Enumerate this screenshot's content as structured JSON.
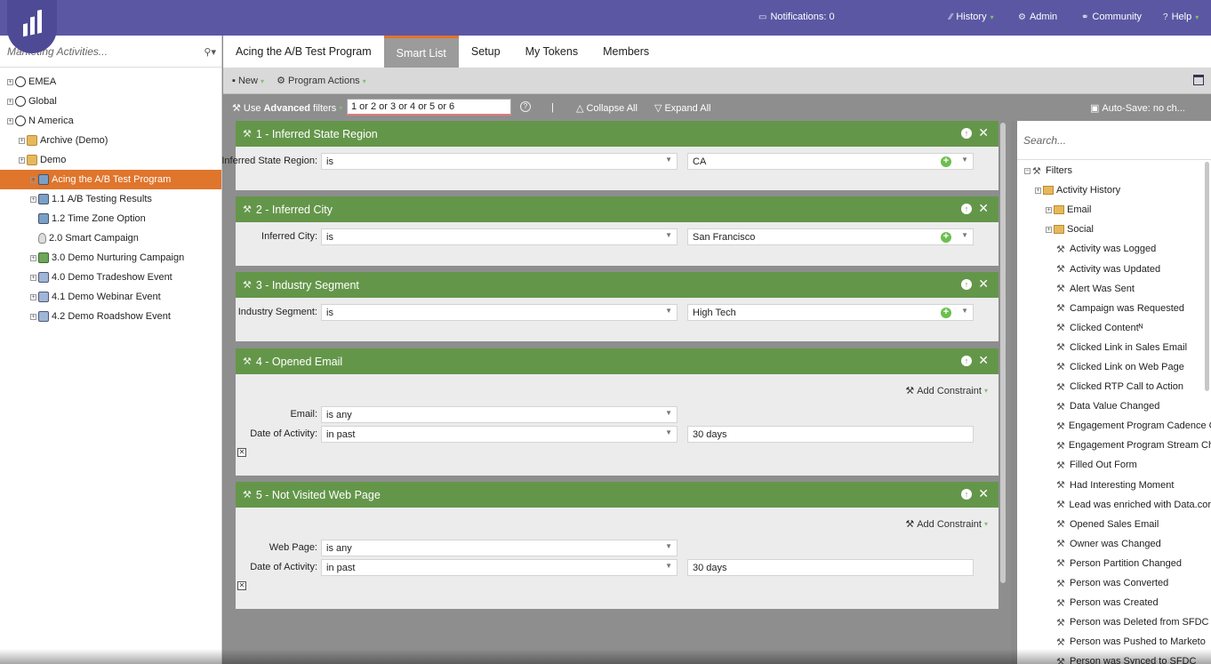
{
  "topbar": {
    "notifications": "Notifications: 0",
    "history": "History",
    "admin": "Admin",
    "community": "Community",
    "help": "Help"
  },
  "left": {
    "search_placeholder": "Marketing Activities...",
    "tree": [
      {
        "label": "EMEA",
        "icon": "globe-icon",
        "indent": 0
      },
      {
        "label": "Global",
        "icon": "globe-icon",
        "indent": 0
      },
      {
        "label": "N America",
        "icon": "globe-icon",
        "indent": 0
      },
      {
        "label": "Archive (Demo)",
        "icon": "folder-icon",
        "indent": 1
      },
      {
        "label": "Demo",
        "icon": "folder-icon",
        "indent": 1
      },
      {
        "label": "Acing the A/B Test Program",
        "icon": "program-icon",
        "indent": 2,
        "selected": true
      },
      {
        "label": "1.1 A/B Testing Results",
        "icon": "program-icon",
        "indent": 2
      },
      {
        "label": "1.2 Time Zone Option",
        "icon": "program-icon",
        "indent": 2
      },
      {
        "label": "2.0 Smart Campaign",
        "icon": "bulb-icon",
        "indent": 2
      },
      {
        "label": "3.0 Demo Nurturing Campaign",
        "icon": "nurture-icon",
        "indent": 2
      },
      {
        "label": "4.0 Demo Tradeshow Event",
        "icon": "event-icon",
        "indent": 2
      },
      {
        "label": "4.1 Demo Webinar Event",
        "icon": "event-icon",
        "indent": 2
      },
      {
        "label": "4.2 Demo Roadshow Event",
        "icon": "event-icon",
        "indent": 2
      }
    ]
  },
  "tabs": [
    "Acing the A/B Test Program",
    "Smart List",
    "Setup",
    "My Tokens",
    "Members"
  ],
  "active_tab": "Smart List",
  "toolbar": {
    "new_label": "New",
    "program_actions": "Program Actions",
    "use_advanced_prefix": "Use ",
    "use_advanced_bold": "Advanced",
    "use_advanced_suffix": " filters",
    "rule_logic": "1 or 2 or 3 or 4 or 5 or 6",
    "separator": "|",
    "collapse_all": "Collapse All",
    "expand_all": "Expand All",
    "autosave": "Auto-Save: no ch..."
  },
  "filters": [
    {
      "title": "1 - Inferred State Region",
      "rows": [
        {
          "label": "Inferred State Region:",
          "op": "is",
          "value": "CA"
        }
      ]
    },
    {
      "title": "2 - Inferred City",
      "rows": [
        {
          "label": "Inferred City:",
          "op": "is",
          "value": "San Francisco"
        }
      ]
    },
    {
      "title": "3 - Industry Segment",
      "rows": [
        {
          "label": "Industry Segment:",
          "op": "is",
          "value": "High Tech"
        }
      ]
    },
    {
      "title": "4 - Opened Email",
      "add_constraint": "Add Constraint",
      "rows": [
        {
          "label": "Email:",
          "op": "is any"
        },
        {
          "label": "Date of Activity:",
          "op": "in past",
          "value": "30 days"
        }
      ]
    },
    {
      "title": "5 - Not Visited Web Page",
      "add_constraint": "Add Constraint",
      "rows": [
        {
          "label": "Web Page:",
          "op": "is any"
        },
        {
          "label": "Date of Activity:",
          "op": "in past",
          "value": "30 days"
        }
      ]
    }
  ],
  "right": {
    "search_placeholder": "Search...",
    "filters_label": "Filters",
    "activity_history": "Activity History",
    "email": "Email",
    "social": "Social",
    "items": [
      "Activity was Logged",
      "Activity was Updated",
      "Alert Was Sent",
      "Campaign was Requested",
      "Clicked Contentᴺ",
      "Clicked Link in Sales Email",
      "Clicked Link on Web Page",
      "Clicked RTP Call to Action",
      "Data Value Changed",
      "Engagement Program Cadence C",
      "Engagement Program Stream Ch",
      "Filled Out Form",
      "Had Interesting Moment",
      "Lead was enriched with Data.cor",
      "Opened Sales Email",
      "Owner was Changed",
      "Person Partition Changed",
      "Person was Converted",
      "Person was Created",
      "Person was Deleted from SFDC",
      "Person was Pushed to Marketo",
      "Person was Synced to SFDC"
    ]
  },
  "colors": {
    "brand": "#5b57a3",
    "accent": "#e0752c",
    "filter_header": "#64964a"
  }
}
